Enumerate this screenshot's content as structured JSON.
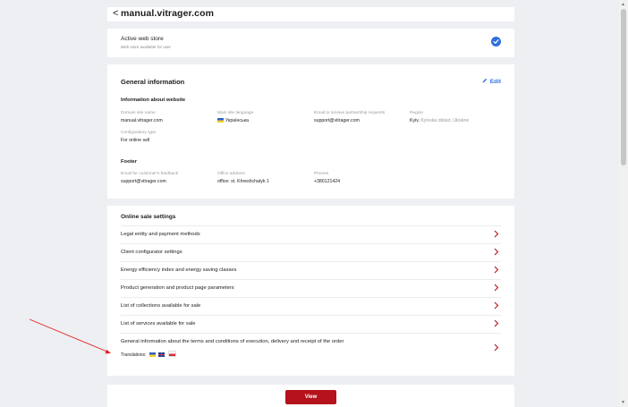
{
  "header": {
    "back_label": "<",
    "title": "manual.vitrager.com"
  },
  "store": {
    "title": "Active web store",
    "subtitle": "Web store available for user"
  },
  "general": {
    "title": "General information",
    "edit_label": "Edit",
    "website": {
      "title": "Information about website",
      "fields": [
        {
          "label": "Domain site name",
          "value": "manual.vitrager.com"
        },
        {
          "label": "Main site language",
          "value": "Українська"
        },
        {
          "label": "Email to receive partnership requests",
          "value": "support@vitrager.com"
        },
        {
          "label": "Region",
          "value": "Kyiv,",
          "muted": "Kyivska oblast, Ukraine"
        },
        {
          "label": "Configuratory type",
          "value": "For online sell"
        }
      ]
    },
    "footer": {
      "title": "Footer",
      "fields": [
        {
          "label": "Email for customer's feedback",
          "value": "support@vitrager.com"
        },
        {
          "label": "Office address",
          "value": "office: st. Khreshchatyk 1"
        },
        {
          "label": "Phones",
          "value": "+380121424"
        }
      ]
    }
  },
  "online": {
    "title": "Online sale settings",
    "items": [
      "Legal entity and payment methods",
      "Client configurator settings",
      "Energy efficiency index and energy saving classes",
      "Product generation and product page parameters",
      "List of collections available for sale",
      "List of services available for sale",
      "General information about the terms and conditions of execution, delivery and receipt of the order"
    ],
    "translations_label": "Translations:"
  },
  "actions": {
    "view_label": "View"
  },
  "colors": {
    "accent": "#2f6fdc",
    "primary_button": "#b5121b",
    "annotation_arrow": "#e02020",
    "background": "#eeeff2"
  }
}
